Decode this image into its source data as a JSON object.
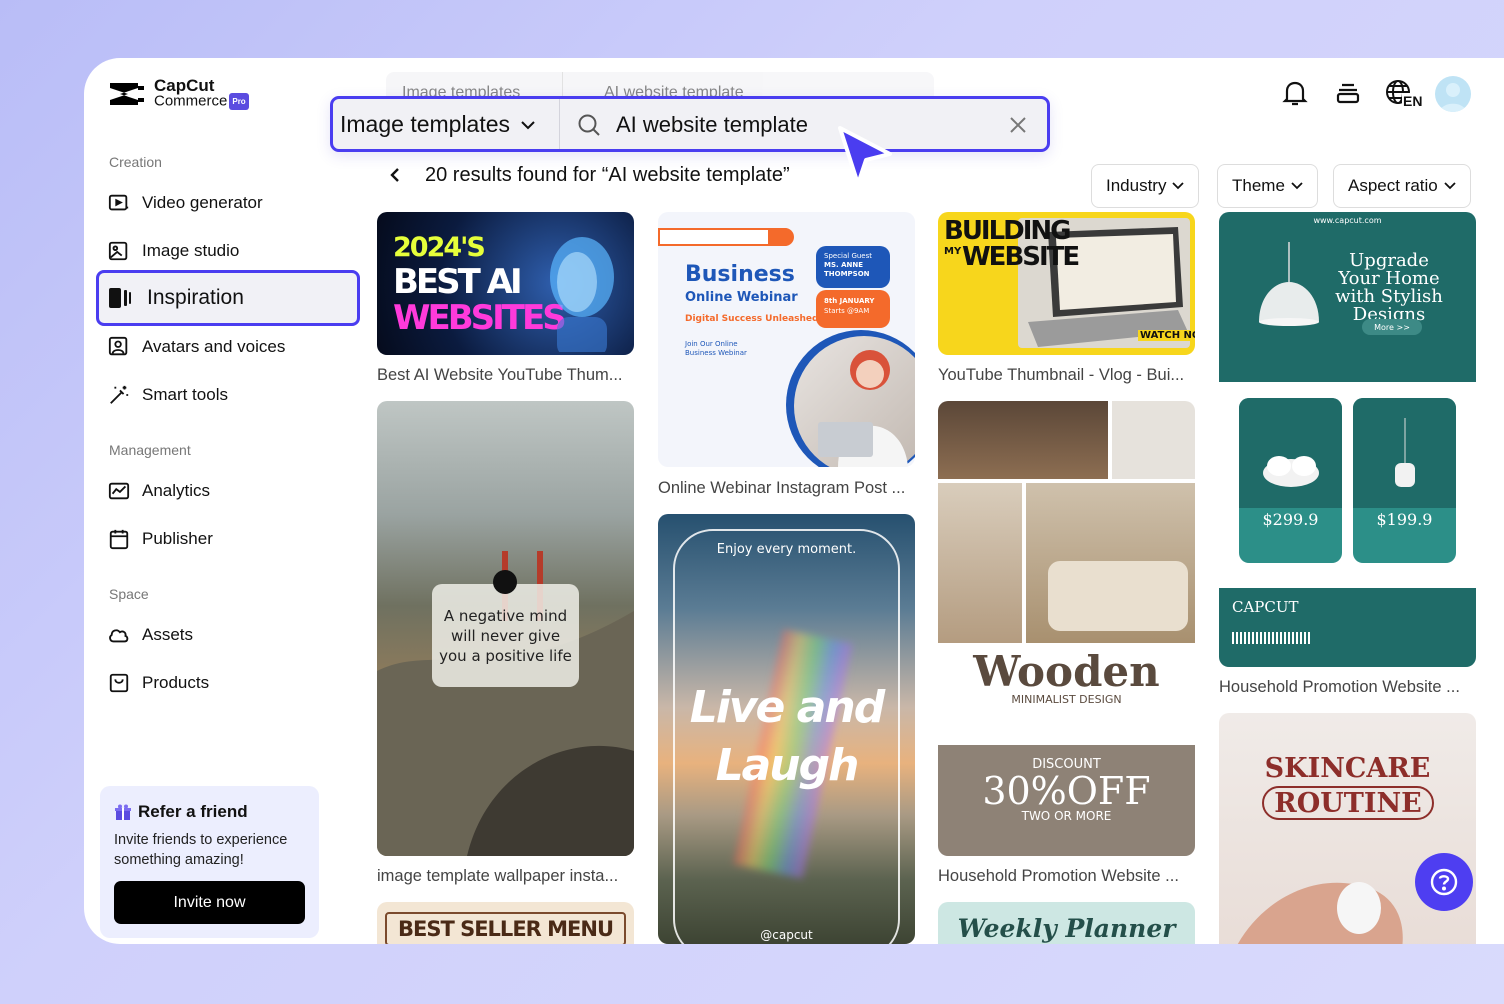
{
  "brand": {
    "name_line1": "CapCut",
    "name_line2": "Commerce",
    "badge": "Pro"
  },
  "search": {
    "category": "Image templates",
    "query": "AI website template"
  },
  "sidebar": {
    "sections": [
      {
        "label": "Creation"
      },
      {
        "label": "Management"
      },
      {
        "label": "Space"
      }
    ],
    "items": [
      {
        "label": "Video generator",
        "icon": "video-generator-icon"
      },
      {
        "label": "Image studio",
        "icon": "image-studio-icon"
      },
      {
        "label": "Inspiration",
        "icon": "inspiration-icon",
        "active": true
      },
      {
        "label": "Avatars and voices",
        "icon": "avatar-voices-icon"
      },
      {
        "label": "Smart tools",
        "icon": "magic-wand-icon"
      },
      {
        "label": "Analytics",
        "icon": "analytics-icon"
      },
      {
        "label": "Publisher",
        "icon": "calendar-icon"
      },
      {
        "label": "Assets",
        "icon": "cloud-icon"
      },
      {
        "label": "Products",
        "icon": "product-box-icon"
      }
    ],
    "refer": {
      "title": "Refer a friend",
      "description": "Invite friends to experience something amazing!",
      "button": "Invite now"
    }
  },
  "header": {
    "icons": [
      "bell-icon",
      "stack-icon",
      "globe-language-icon"
    ],
    "language": "EN"
  },
  "results": {
    "title": "20 results found for “AI website template”",
    "filters": [
      "Industry",
      "Theme",
      "Aspect ratio"
    ]
  },
  "templates": [
    {
      "caption": "Best AI Website YouTube Thum...",
      "t1": "2024'S",
      "t2": "BEST AI",
      "t3": "WEBSITES"
    },
    {
      "caption": "image template wallpaper insta...",
      "quote": "A negative mind will never give you a positive life"
    },
    {
      "caption": "",
      "t1": "BEST SELLER MENU"
    },
    {
      "caption": "Online Webinar Instagram Post ...",
      "t1": "Business",
      "t2": "Online Webinar",
      "t3": "Digital Success Unleashed",
      "t4": "Join Our Online Business Webinar",
      "guest": "Special Guest",
      "guest_name": "MS. ANNE THOMPSON",
      "date": "8th JANUARY",
      "time": "Starts @9AM"
    },
    {
      "caption": "",
      "t1": "Enjoy every moment.",
      "t2": "Live and",
      "t3": "Laugh",
      "handle": "@capcut"
    },
    {
      "caption": "YouTube Thumbnail - Vlog - Bui...",
      "t1": "BUILDING",
      "t2": "MY",
      "t3": "WEBSITE",
      "t4": "WATCH NOW"
    },
    {
      "caption": "Household Promotion Website ...",
      "t1": "Wooden",
      "t2": "MINIMALIST DESIGN",
      "t3": "DISCOUNT",
      "t4": "30%OFF",
      "t5": "TWO OR MORE"
    },
    {
      "caption": "",
      "t1": "Weekly Planner"
    },
    {
      "caption": "Household Promotion Website ...",
      "url": "www.capcut.com",
      "t1": "Upgrade Your Home with Stylish Designs",
      "more": "More >>",
      "price1": "$299.9",
      "price2": "$199.9",
      "brand": "CAPCUT"
    },
    {
      "caption": "",
      "t1": "SKINCARE",
      "t2": "ROUTINE"
    }
  ],
  "colors": {
    "accent": "#4a3df0",
    "teal": "#1f6b68"
  }
}
